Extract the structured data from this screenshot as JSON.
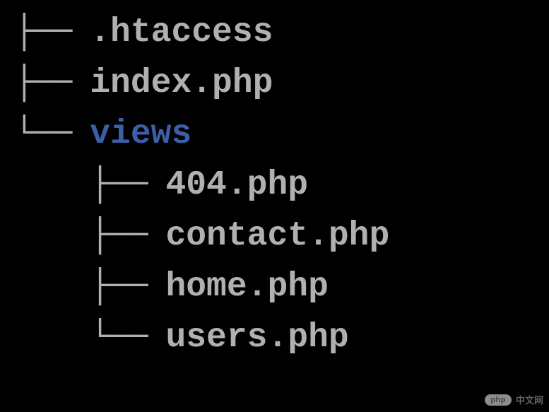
{
  "tree": {
    "root": [
      {
        "name": ".htaccess",
        "type": "file",
        "connector": "├── "
      },
      {
        "name": "index.php",
        "type": "file",
        "connector": "├── "
      },
      {
        "name": "views",
        "type": "dir",
        "connector": "└── ",
        "children": [
          {
            "name": "404.php",
            "type": "file",
            "connector": "    ├── "
          },
          {
            "name": "contact.php",
            "type": "file",
            "connector": "    ├── "
          },
          {
            "name": "home.php",
            "type": "file",
            "connector": "    ├── "
          },
          {
            "name": "users.php",
            "type": "file",
            "connector": "    └── "
          }
        ]
      }
    ]
  },
  "watermark": {
    "badge": "php",
    "text": "中文网"
  }
}
